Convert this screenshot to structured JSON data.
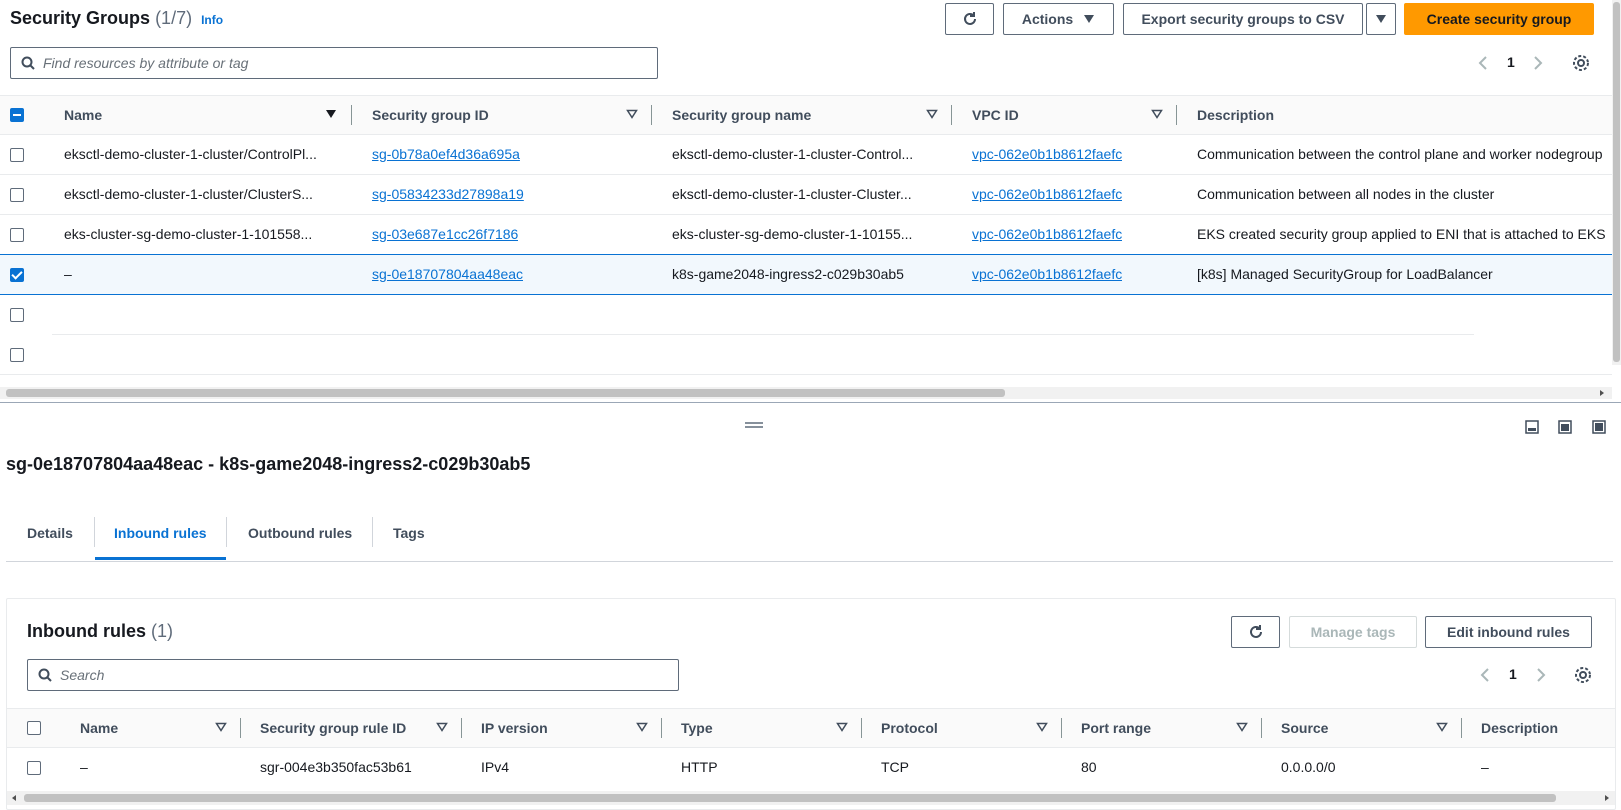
{
  "top_panel": {
    "title": "Security Groups",
    "count": "(1/7)",
    "info": "Info",
    "actions_label": "Actions",
    "export_label": "Export security groups to CSV",
    "create_label": "Create security group",
    "search_placeholder": "Find resources by attribute or tag",
    "page_number": "1",
    "columns": [
      "Name",
      "Security group ID",
      "Security group name",
      "VPC ID",
      "Description"
    ],
    "rows": [
      {
        "name": "eksctl-demo-cluster-1-cluster/ControlPl...",
        "sg_id": "sg-0b78a0ef4d36a695a",
        "sg_name": "eksctl-demo-cluster-1-cluster-Control...",
        "vpc_id": "vpc-062e0b1b8612faefc",
        "description": "Communication between the control plane and worker nodegroup"
      },
      {
        "name": "eksctl-demo-cluster-1-cluster/ClusterS...",
        "sg_id": "sg-05834233d27898a19",
        "sg_name": "eksctl-demo-cluster-1-cluster-Cluster...",
        "vpc_id": "vpc-062e0b1b8612faefc",
        "description": "Communication between all nodes in the cluster"
      },
      {
        "name": "eks-cluster-sg-demo-cluster-1-101558...",
        "sg_id": "sg-03e687e1cc26f7186",
        "sg_name": "eks-cluster-sg-demo-cluster-1-10155...",
        "vpc_id": "vpc-062e0b1b8612faefc",
        "description": "EKS created security group applied to ENI that is attached to EKS"
      },
      {
        "name": "–",
        "sg_id": "sg-0e18707804aa48eac",
        "sg_name": "k8s-game2048-ingress2-c029b30ab5",
        "vpc_id": "vpc-062e0b1b8612faefc",
        "description": "[k8s] Managed SecurityGroup for LoadBalancer"
      }
    ]
  },
  "detail_panel": {
    "title": "sg-0e18707804aa48eac - k8s-game2048-ingress2-c029b30ab5",
    "tabs": [
      "Details",
      "Inbound rules",
      "Outbound rules",
      "Tags"
    ],
    "active_tab": "Inbound rules",
    "inbound": {
      "title": "Inbound rules",
      "count": "(1)",
      "manage_tags_label": "Manage tags",
      "edit_label": "Edit inbound rules",
      "search_placeholder": "Search",
      "page_number": "1",
      "columns": [
        "Name",
        "Security group rule ID",
        "IP version",
        "Type",
        "Protocol",
        "Port range",
        "Source",
        "Description"
      ],
      "rows": [
        {
          "name": "–",
          "rule_id": "sgr-004e3b350fac53b61",
          "ip_version": "IPv4",
          "type": "HTTP",
          "protocol": "TCP",
          "port_range": "80",
          "source": "0.0.0.0/0",
          "description": "–"
        }
      ]
    }
  },
  "colors": {
    "accent": "#ff9900",
    "link": "#0972d3",
    "selected_row": "#f2f8fd"
  }
}
